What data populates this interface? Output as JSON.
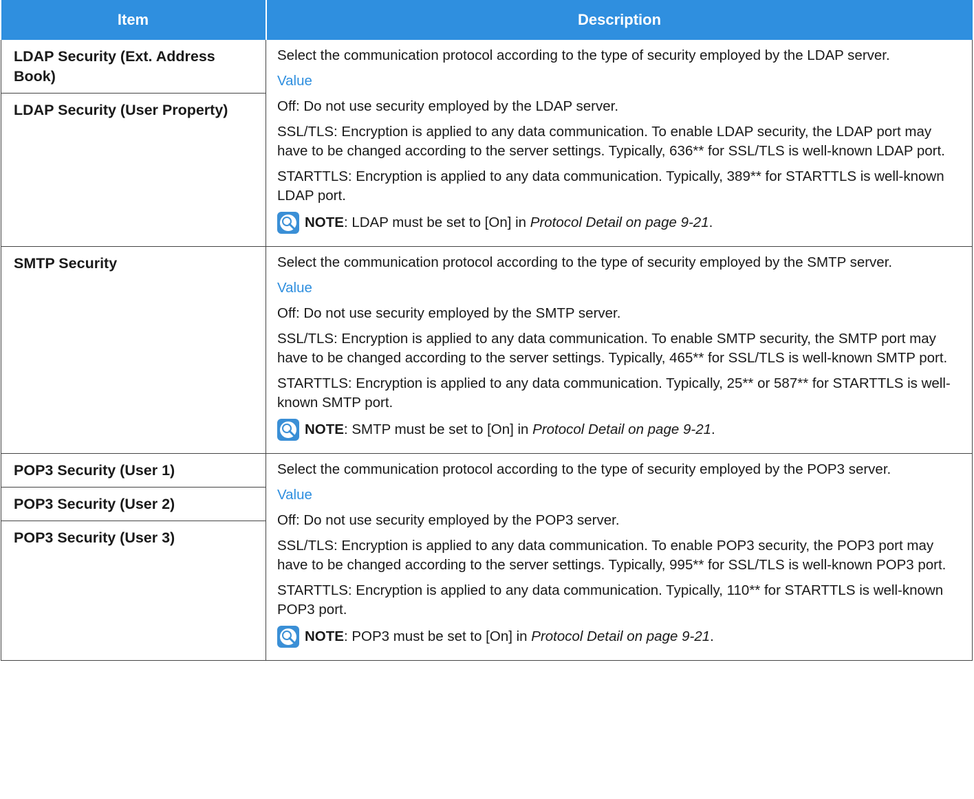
{
  "header": {
    "item": "Item",
    "description": "Description"
  },
  "rows": [
    {
      "items": [
        "LDAP Security (Ext. Address Book)",
        "LDAP Security (User Property)"
      ],
      "intro": "Select the communication protocol according to the type of security employed by the LDAP server.",
      "value_label": "Value",
      "off": "Off: Do not use security employed by the LDAP server.",
      "ssltls": "SSL/TLS: Encryption is applied to any data communication. To enable LDAP security, the LDAP port may have to be changed according to the server settings. Typically, 636** for SSL/TLS is well-known LDAP port.",
      "starttls": "STARTTLS: Encryption is applied to any data communication. Typically, 389** for STARTTLS is well-known LDAP port.",
      "note_label": "NOTE",
      "note_text": ": LDAP must be set to [On] in ",
      "note_ref": "Protocol Detail on page 9-21",
      "note_end": "."
    },
    {
      "items": [
        "SMTP Security"
      ],
      "intro": "Select the communication protocol according to the type of security employed by the SMTP server.",
      "value_label": "Value",
      "off": "Off: Do not use security employed by the SMTP server.",
      "ssltls": "SSL/TLS: Encryption is applied to any data communication. To enable SMTP security, the SMTP port may have to be changed according to the server settings. Typically, 465** for SSL/TLS is well-known SMTP port.",
      "starttls": "STARTTLS: Encryption is applied to any data communication. Typically, 25** or 587** for STARTTLS is well-known SMTP port.",
      "note_label": "NOTE",
      "note_text": ": SMTP must be set to [On] in ",
      "note_ref": "Protocol Detail on page 9-21",
      "note_end": "."
    },
    {
      "items": [
        "POP3 Security (User 1)",
        "POP3 Security (User 2)",
        "POP3 Security (User 3)"
      ],
      "intro": "Select the communication protocol according to the type of security employed by the POP3 server.",
      "value_label": "Value",
      "off": "Off: Do not use security employed by the POP3 server.",
      "ssltls": "SSL/TLS: Encryption is applied to any data communication. To enable POP3 security, the POP3 port may have to be changed according to the server settings. Typically, 995** for SSL/TLS is well-known POP3 port.",
      "starttls": "STARTTLS: Encryption is applied to any data communication. Typically, 110** for STARTTLS is well-known POP3 port.",
      "note_label": "NOTE",
      "note_text": ": POP3 must be set to [On] in ",
      "note_ref": "Protocol Detail on page 9-21",
      "note_end": "."
    }
  ],
  "colors": {
    "header_bg": "#2f8fdf",
    "value_label": "#2f8fdf",
    "border": "#444444"
  },
  "icons": {
    "note": "lightbulb-note-icon"
  }
}
